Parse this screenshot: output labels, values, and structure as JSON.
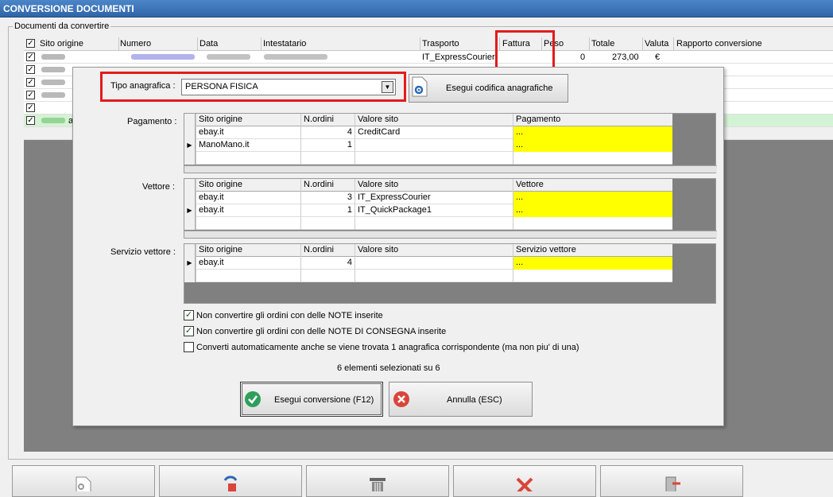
{
  "window": {
    "title": "CONVERSIONE DOCUMENTI"
  },
  "group_label": "Documenti da convertire",
  "bg_columns": [
    "Sito origine",
    "Numero",
    "Data",
    "Intestatario",
    "Trasporto",
    "Fattura",
    "Peso",
    "Totale",
    "Valuta",
    "Rapporto conversione"
  ],
  "bg_row1": {
    "trasporto": "IT_ExpressCourier",
    "peso": "0",
    "totale": "273,00",
    "valuta": "€"
  },
  "bg_row6_partial": "a",
  "dialog": {
    "tipo_label": "Tipo anagrafica :",
    "tipo_value": "PERSONA FISICA",
    "esegui_codifica": "Esegui codifica anagrafiche",
    "pagamento": {
      "label": "Pagamento :",
      "headers": [
        "Sito origine",
        "N.ordini",
        "Valore sito",
        "Pagamento"
      ],
      "rows": [
        {
          "sito": "ebay.it",
          "n": "4",
          "valore": "CreditCard",
          "target": "..."
        },
        {
          "sito": "ManoMano.it",
          "n": "1",
          "valore": "",
          "target": "..."
        }
      ]
    },
    "vettore": {
      "label": "Vettore :",
      "headers": [
        "Sito origine",
        "N.ordini",
        "Valore sito",
        "Vettore"
      ],
      "rows": [
        {
          "sito": "ebay.it",
          "n": "3",
          "valore": "IT_ExpressCourier",
          "target": "..."
        },
        {
          "sito": "ebay.it",
          "n": "1",
          "valore": "IT_QuickPackage1",
          "target": "..."
        }
      ]
    },
    "servizio": {
      "label": "Servizio vettore :",
      "headers": [
        "Sito origine",
        "N.ordini",
        "Valore sito",
        "Servizio vettore"
      ],
      "rows": [
        {
          "sito": "ebay.it",
          "n": "4",
          "valore": "",
          "target": "..."
        }
      ]
    },
    "options": [
      {
        "label": "Non convertire gli ordini con delle NOTE inserite",
        "checked": true
      },
      {
        "label": "Non convertire gli ordini con delle NOTE DI CONSEGNA inserite",
        "checked": true
      },
      {
        "label": "Converti automaticamente anche se viene trovata 1 anagrafica corrispondente (ma non piu' di una)",
        "checked": false
      }
    ],
    "selection_count": "6 elementi selezionati su 6",
    "esegui_conversione": "Esegui conversione (F12)",
    "annulla": "Annulla (ESC)"
  },
  "checkmark": "✓",
  "row_pointer": "▶",
  "combo_arrow": "▼",
  "accent_colors": {
    "highlight": "#e31b1b",
    "yellow": "#ffff00",
    "title": "#2e65a8"
  }
}
